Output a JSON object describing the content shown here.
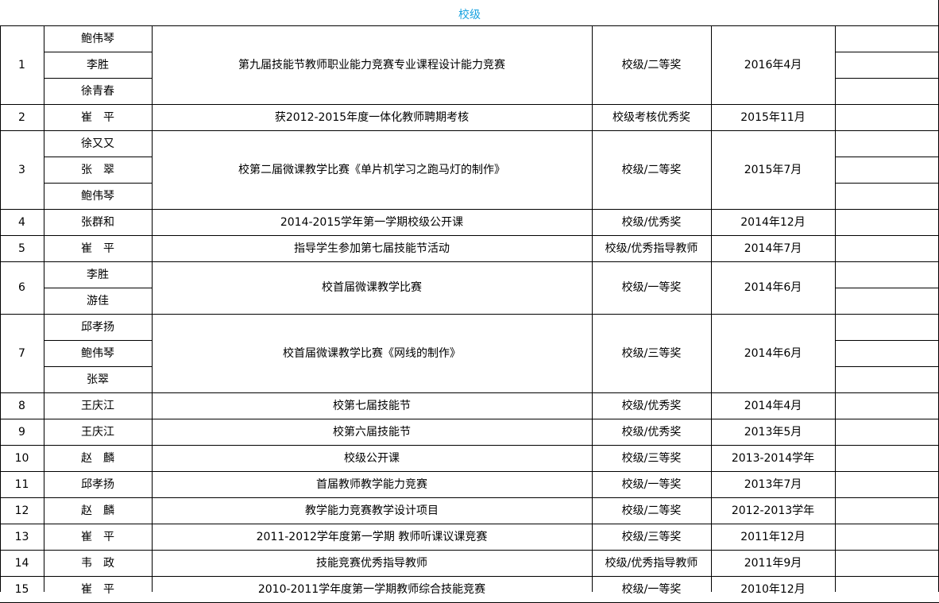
{
  "header": {
    "title": "校级"
  },
  "rows": [
    {
      "no": "1",
      "names": [
        "鲍伟琴",
        "李胜",
        "徐青春"
      ],
      "event": "第九届技能节教师职业能力竞赛专业课程设计能力竞赛",
      "award": "校级/二等奖",
      "date": "2016年4月"
    },
    {
      "no": "2",
      "names": [
        "崔　平"
      ],
      "event": "获2012-2015年度一体化教师聘期考核",
      "award": "校级考核优秀奖",
      "date": "2015年11月"
    },
    {
      "no": "3",
      "names": [
        "徐又又",
        "张　翠",
        "鲍伟琴"
      ],
      "event": "校第二届微课教学比赛《单片机学习之跑马灯的制作》",
      "award": "校级/二等奖",
      "date": "2015年7月"
    },
    {
      "no": "4",
      "names": [
        "张群和"
      ],
      "event": "2014-2015学年第一学期校级公开课",
      "award": "校级/优秀奖",
      "date": "2014年12月"
    },
    {
      "no": "5",
      "names": [
        "崔　平"
      ],
      "event": "指导学生参加第七届技能节活动",
      "award": "校级/优秀指导教师",
      "date": "2014年7月"
    },
    {
      "no": "6",
      "names": [
        "李胜",
        "游佳"
      ],
      "event": "校首届微课教学比赛",
      "award": "校级/一等奖",
      "date": "2014年6月"
    },
    {
      "no": "7",
      "names": [
        "邱孝扬",
        "鲍伟琴",
        "张翠"
      ],
      "event": "校首届微课教学比赛《网线的制作》",
      "award": "校级/三等奖",
      "date": "2014年6月"
    },
    {
      "no": "8",
      "names": [
        "王庆江"
      ],
      "event": "校第七届技能节",
      "award": "校级/优秀奖",
      "date": "2014年4月"
    },
    {
      "no": "9",
      "names": [
        "王庆江"
      ],
      "event": "校第六届技能节",
      "award": "校级/优秀奖",
      "date": "2013年5月"
    },
    {
      "no": "10",
      "names": [
        "赵　麟"
      ],
      "event": "校级公开课",
      "award": "校级/三等奖",
      "date": "2013-2014学年"
    },
    {
      "no": "11",
      "names": [
        "邱孝扬"
      ],
      "event": "首届教师教学能力竞赛",
      "award": "校级/一等奖",
      "date": "2013年7月"
    },
    {
      "no": "12",
      "names": [
        "赵　麟"
      ],
      "event": "教学能力竞赛教学设计项目",
      "award": "校级/二等奖",
      "date": "2012-2013学年"
    },
    {
      "no": "13",
      "names": [
        "崔　平"
      ],
      "event": "2011-2012学年度第一学期 教师听课议课竞赛",
      "award": "校级/三等奖",
      "date": "2011年12月"
    },
    {
      "no": "14",
      "names": [
        "韦　政"
      ],
      "event": "技能竞赛优秀指导教师",
      "award": "校级/优秀指导教师",
      "date": "2011年9月"
    },
    {
      "no": "15",
      "names": [
        "崔　平"
      ],
      "event": "2010-2011学年度第一学期教师综合技能竞赛",
      "award": "校级/一等奖",
      "date": "2010年12月"
    }
  ]
}
